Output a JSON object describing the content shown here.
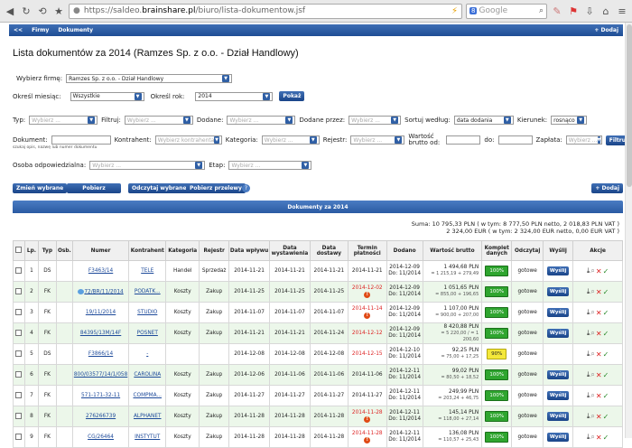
{
  "browser": {
    "url_prefix": "https://saldeo.",
    "url_domain": "brainshare.pl",
    "url_path": "/biuro/lista-dokumentow.jsf",
    "search_placeholder": "Google",
    "search_badge": "8"
  },
  "nav": {
    "back": "<<",
    "firms": "Firmy",
    "documents": "Dokumenty",
    "add": "+ Dodaj"
  },
  "page": {
    "title": "Lista dokumentów za 2014 (Ramzes Sp. z o.o. - Dział Handlowy)"
  },
  "filters": {
    "firm_label": "Wybierz firmę:",
    "firm_value": "Ramzes Sp. z o.o. - Dział Handlowy",
    "month_label": "Określ miesiąc:",
    "month_value": "Wszystkie",
    "year_label": "Określ rok:",
    "year_value": "2014",
    "show_button": "Pokaż",
    "type_label": "Typ:",
    "type_ph": "Wybierz ...",
    "filter_label": "Filtruj:",
    "filter_ph": "Wybierz ...",
    "added_label": "Dodane:",
    "added_ph": "Wybierz ...",
    "added_by_label": "Dodane przez:",
    "added_by_ph": "Wybierz ...",
    "sort_label": "Sortuj według:",
    "sort_value": "data dodania",
    "direction_label": "Kierunek:",
    "direction_value": "rosnąco",
    "doc_label": "Dokument:",
    "doc_hint": "szukaj opis, nazwę lub numer dokumentu",
    "contractor_label": "Kontrahent:",
    "contractor_ph": "Wybierz kontrahenta",
    "category_label": "Kategoria:",
    "category_ph": "Wybierz ...",
    "register_label": "Rejestr:",
    "register_ph": "Wybierz ...",
    "gross_label": "Wartość brutto od:",
    "to_label": "do:",
    "payment_label": "Zapłata:",
    "payment_ph": "Wybierz ...",
    "filter_button": "Filtruj",
    "person_label": "Osoba odpowiedzialna:",
    "person_ph": "Wybierz ...",
    "stage_label": "Etap:",
    "stage_ph": "Wybierz ..."
  },
  "toolbar": {
    "change": "Zmień wybrane",
    "download": "Pobierz",
    "read": "Odczytaj wybrane",
    "transfers": "Pobierz przelewy",
    "add": "+ Dodaj"
  },
  "table_title": "Dokumenty za 2014",
  "sums": {
    "line1": "Suma:  10 795,33 PLN  ( w tym: 8 777,50 PLN netto, 2 018,83 PLN VAT )",
    "line2": "2 324,00 EUR  ( w tym: 2 324,00 EUR netto, 0,00 EUR VAT )"
  },
  "columns": [
    "Lp.",
    "Typ",
    "Osb.",
    "Numer",
    "Kontrahent",
    "Kategoria",
    "Rejestr",
    "Data wpływu",
    "Data wystawienia",
    "Data dostawy",
    "Termin płatności",
    "Dodano",
    "Wartość brutto",
    "Komplet danych",
    "Odczytaj",
    "Wyślij",
    "Akcje"
  ],
  "rows": [
    {
      "lp": "1",
      "typ": "DS",
      "numer": "F3463/14",
      "kontrahent": "TELE",
      "kategoria": "Handel",
      "rejestr": "Sprzedaż",
      "wplyw": "2014-11-21",
      "wystawienia": "2014-11-21",
      "dostawy": "2014-11-21",
      "termin": "2014-11-21",
      "termin_red": false,
      "termin_excl": false,
      "dodano": "2014-12-09",
      "dodano_do": "Do: 11/2014",
      "brutto": "1 494,68 PLN",
      "brutto_sub": "= 1 215,19 + 279,49",
      "komplet": "100%",
      "odczytaj": "gotowe",
      "wyslij": "Wyślij",
      "bubble": false
    },
    {
      "lp": "2",
      "typ": "FK",
      "numer": "72/BR/11/2014",
      "kontrahent": "PODATK...",
      "kategoria": "Koszty",
      "rejestr": "Zakup",
      "wplyw": "2014-11-25",
      "wystawienia": "2014-11-25",
      "dostawy": "2014-11-25",
      "termin": "2014-12-02",
      "termin_red": true,
      "termin_excl": true,
      "dodano": "2014-12-09",
      "dodano_do": "Do: 11/2014",
      "brutto": "1 051,65 PLN",
      "brutto_sub": "= 855,00 + 196,65",
      "komplet": "100%",
      "odczytaj": "gotowe",
      "wyslij": "Wyślij",
      "bubble": true
    },
    {
      "lp": "3",
      "typ": "FK",
      "numer": "19/11/2014",
      "kontrahent": "STUDIO",
      "kategoria": "Koszty",
      "rejestr": "Zakup",
      "wplyw": "2014-11-07",
      "wystawienia": "2014-11-07",
      "dostawy": "2014-11-07",
      "termin": "2014-11-14",
      "termin_red": true,
      "termin_excl": true,
      "dodano": "2014-12-09",
      "dodano_do": "Do: 11/2014",
      "brutto": "1 107,00 PLN",
      "brutto_sub": "= 900,00 + 207,00",
      "komplet": "100%",
      "odczytaj": "gotowe",
      "wyslij": "Wyślij",
      "bubble": false
    },
    {
      "lp": "4",
      "typ": "FK",
      "numer": "84395/13M/14F",
      "kontrahent": "POSNET",
      "kategoria": "Koszty",
      "rejestr": "Zakup",
      "wplyw": "2014-11-21",
      "wystawienia": "2014-11-21",
      "dostawy": "2014-11-24",
      "termin": "2014-12-12",
      "termin_red": true,
      "termin_excl": false,
      "dodano": "2014-12-09",
      "dodano_do": "Do: 11/2014",
      "brutto": "8 420,88 PLN",
      "brutto_sub": "= 5 220,00 / = 1 200,60",
      "komplet": "100%",
      "odczytaj": "gotowe",
      "wyslij": "Wyślij",
      "bubble": false
    },
    {
      "lp": "5",
      "typ": "DS",
      "numer": "F3866/14",
      "kontrahent": "-",
      "kategoria": "",
      "rejestr": "",
      "wplyw": "2014-12-08",
      "wystawienia": "2014-12-08",
      "dostawy": "2014-12-08",
      "termin": "2014-12-15",
      "termin_red": true,
      "termin_excl": false,
      "dodano": "2014-12-10",
      "dodano_do": "Do: 11/2014",
      "brutto": "92,25 PLN",
      "brutto_sub": "= 75,00 + 17,25",
      "komplet": "90%",
      "odczytaj": "gotowe",
      "wyslij": "",
      "bubble": false
    },
    {
      "lp": "6",
      "typ": "FK",
      "numer": "800/03577/14/1/058",
      "kontrahent": "CAROLINA",
      "kategoria": "Koszty",
      "rejestr": "Zakup",
      "wplyw": "2014-12-06",
      "wystawienia": "2014-11-06",
      "dostawy": "2014-11-06",
      "termin": "2014-11-06",
      "termin_red": false,
      "termin_excl": false,
      "dodano": "2014-12-11",
      "dodano_do": "Do: 11/2014",
      "brutto": "99,02 PLN",
      "brutto_sub": "= 80,50 + 18,52",
      "komplet": "100%",
      "odczytaj": "gotowe",
      "wyslij": "Wyślij",
      "bubble": false
    },
    {
      "lp": "7",
      "typ": "FK",
      "numer": "571-171-32-11",
      "kontrahent": "COMPMA...",
      "kategoria": "Koszty",
      "rejestr": "Zakup",
      "wplyw": "2014-11-27",
      "wystawienia": "2014-11-27",
      "dostawy": "2014-11-27",
      "termin": "2014-11-27",
      "termin_red": false,
      "termin_excl": false,
      "dodano": "2014-12-11",
      "dodano_do": "Do: 11/2014",
      "brutto": "249,99 PLN",
      "brutto_sub": "= 203,24 + 46,75",
      "komplet": "100%",
      "odczytaj": "gotowe",
      "wyslij": "Wyślij",
      "bubble": false
    },
    {
      "lp": "8",
      "typ": "FK",
      "numer": "276266739",
      "kontrahent": "ALPHANET",
      "kategoria": "Koszty",
      "rejestr": "Zakup",
      "wplyw": "2014-11-28",
      "wystawienia": "2014-11-28",
      "dostawy": "2014-11-28",
      "termin": "2014-11-28",
      "termin_red": true,
      "termin_excl": true,
      "dodano": "2014-12-11",
      "dodano_do": "Do: 11/2014",
      "brutto": "145,14 PLN",
      "brutto_sub": "= 118,00 + 27,14",
      "komplet": "100%",
      "odczytaj": "gotowe",
      "wyslij": "Wyślij",
      "bubble": false
    },
    {
      "lp": "9",
      "typ": "FK",
      "numer": "CG/26464",
      "kontrahent": "INSTYTUT",
      "kategoria": "Koszty",
      "rejestr": "Zakup",
      "wplyw": "2014-11-28",
      "wystawienia": "2014-11-28",
      "dostawy": "2014-11-28",
      "termin": "2014-11-28",
      "termin_red": true,
      "termin_excl": true,
      "dodano": "2014-12-11",
      "dodano_do": "Do: 11/2014",
      "brutto": "136,08 PLN",
      "brutto_sub": "= 110,57 + 25,43",
      "komplet": "100%",
      "odczytaj": "gotowe",
      "wyslij": "Wyślij",
      "bubble": false
    }
  ]
}
